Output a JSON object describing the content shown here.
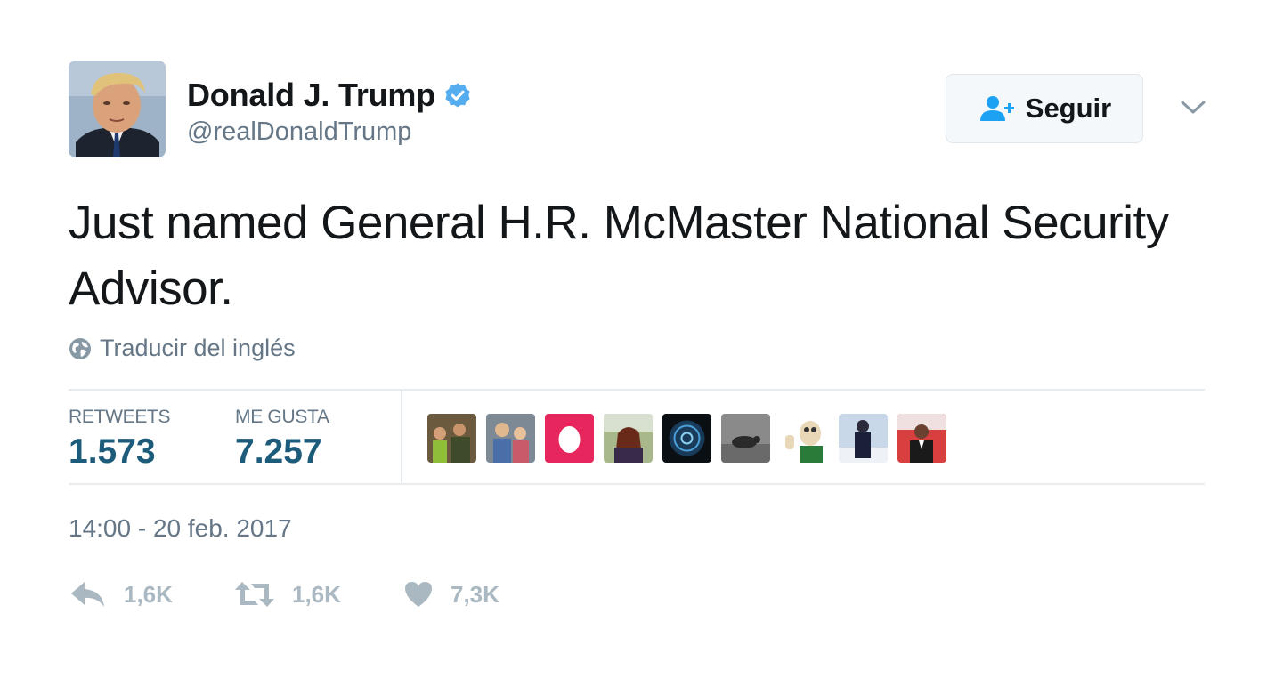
{
  "user": {
    "display_name": "Donald J. Trump",
    "handle": "@realDonaldTrump",
    "avatar_icon": "profile-photo",
    "verified": true,
    "verified_color": "#55acee"
  },
  "follow_button": {
    "label": "Seguir",
    "icon": "follow-user-icon",
    "icon_color": "#1da1f2"
  },
  "menu_icon": "chevron-down-icon",
  "tweet": {
    "text": "Just named General H.R. McMaster National Security Advisor."
  },
  "translate": {
    "label": "Traducir del inglés",
    "icon": "globe-icon"
  },
  "stats": {
    "retweets_label": "RETWEETS",
    "retweets_value": "1.573",
    "likes_label": "ME GUSTA",
    "likes_value": "7.257",
    "value_color": "#1c5b7a"
  },
  "liker_avatars": [
    {
      "name": "liker-avatar-1"
    },
    {
      "name": "liker-avatar-2"
    },
    {
      "name": "liker-avatar-3-egg"
    },
    {
      "name": "liker-avatar-4"
    },
    {
      "name": "liker-avatar-5"
    },
    {
      "name": "liker-avatar-6"
    },
    {
      "name": "liker-avatar-7"
    },
    {
      "name": "liker-avatar-8"
    },
    {
      "name": "liker-avatar-9"
    }
  ],
  "timestamp": "14:00 - 20 feb. 2017",
  "actions": {
    "reply_count": "1,6K",
    "retweet_count": "1,6K",
    "like_count": "7,3K",
    "icon_color": "#aab8c2"
  }
}
